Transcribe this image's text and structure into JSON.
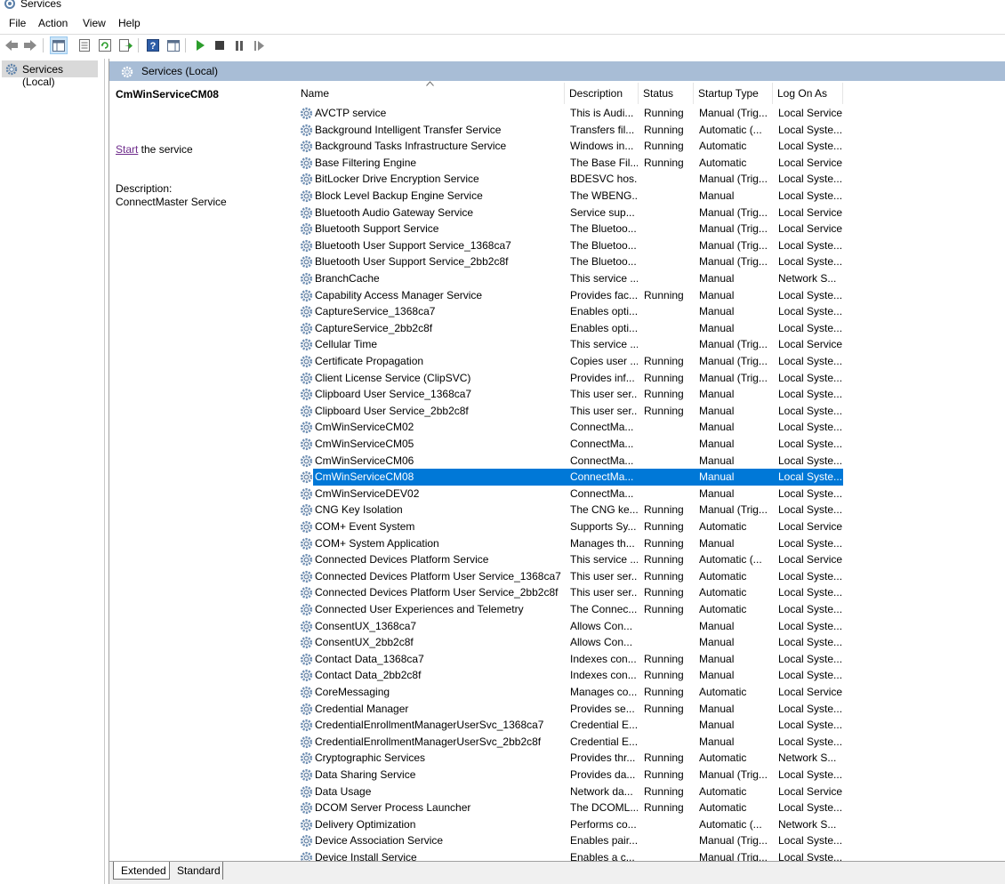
{
  "window": {
    "title": "Services"
  },
  "menu": [
    "File",
    "Action",
    "View",
    "Help"
  ],
  "toolbar": {
    "buttons": [
      "back-icon",
      "forward-icon",
      "show-hide-console-tree-icon",
      "properties-icon",
      "refresh-icon",
      "export-list-icon",
      "help-icon",
      "show-action-pane-icon",
      "start-service-icon",
      "stop-service-icon",
      "pause-service-icon",
      "resume-service-icon"
    ]
  },
  "tree": {
    "root": "Services (Local)"
  },
  "pane": {
    "title": "Services (Local)"
  },
  "details": {
    "service_name": "CmWinServiceCM08",
    "start_link": "Start",
    "start_suffix": " the service",
    "description_label": "Description:",
    "description": "ConnectMaster Service"
  },
  "columns": [
    "Name",
    "Description",
    "Status",
    "Startup Type",
    "Log On As"
  ],
  "selected_index": 22,
  "colors": {
    "selection": "#0078d7",
    "header": "#a8bdd6",
    "link": "#6e2b8b"
  },
  "rows": [
    [
      "AVCTP service",
      "This is Audi...",
      "Running",
      "Manual (Trig...",
      "Local Service"
    ],
    [
      "Background Intelligent Transfer Service",
      "Transfers fil...",
      "Running",
      "Automatic (...",
      "Local Syste..."
    ],
    [
      "Background Tasks Infrastructure Service",
      "Windows in...",
      "Running",
      "Automatic",
      "Local Syste..."
    ],
    [
      "Base Filtering Engine",
      "The Base Fil...",
      "Running",
      "Automatic",
      "Local Service"
    ],
    [
      "BitLocker Drive Encryption Service",
      "BDESVC hos...",
      "",
      "Manual (Trig...",
      "Local Syste..."
    ],
    [
      "Block Level Backup Engine Service",
      "The WBENG...",
      "",
      "Manual",
      "Local Syste..."
    ],
    [
      "Bluetooth Audio Gateway Service",
      "Service sup...",
      "",
      "Manual (Trig...",
      "Local Service"
    ],
    [
      "Bluetooth Support Service",
      "The Bluetoo...",
      "",
      "Manual (Trig...",
      "Local Service"
    ],
    [
      "Bluetooth User Support Service_1368ca7",
      "The Bluetoo...",
      "",
      "Manual (Trig...",
      "Local Syste..."
    ],
    [
      "Bluetooth User Support Service_2bb2c8f",
      "The Bluetoo...",
      "",
      "Manual (Trig...",
      "Local Syste..."
    ],
    [
      "BranchCache",
      "This service ...",
      "",
      "Manual",
      "Network S..."
    ],
    [
      "Capability Access Manager Service",
      "Provides fac...",
      "Running",
      "Manual",
      "Local Syste..."
    ],
    [
      "CaptureService_1368ca7",
      "Enables opti...",
      "",
      "Manual",
      "Local Syste..."
    ],
    [
      "CaptureService_2bb2c8f",
      "Enables opti...",
      "",
      "Manual",
      "Local Syste..."
    ],
    [
      "Cellular Time",
      "This service ...",
      "",
      "Manual (Trig...",
      "Local Service"
    ],
    [
      "Certificate Propagation",
      "Copies user ...",
      "Running",
      "Manual (Trig...",
      "Local Syste..."
    ],
    [
      "Client License Service (ClipSVC)",
      "Provides inf...",
      "Running",
      "Manual (Trig...",
      "Local Syste..."
    ],
    [
      "Clipboard User Service_1368ca7",
      "This user ser...",
      "Running",
      "Manual",
      "Local Syste..."
    ],
    [
      "Clipboard User Service_2bb2c8f",
      "This user ser...",
      "Running",
      "Manual",
      "Local Syste..."
    ],
    [
      "CmWinServiceCM02",
      "ConnectMa...",
      "",
      "Manual",
      "Local Syste..."
    ],
    [
      "CmWinServiceCM05",
      "ConnectMa...",
      "",
      "Manual",
      "Local Syste..."
    ],
    [
      "CmWinServiceCM06",
      "ConnectMa...",
      "",
      "Manual",
      "Local Syste..."
    ],
    [
      "CmWinServiceCM08",
      "ConnectMa...",
      "",
      "Manual",
      "Local Syste..."
    ],
    [
      "CmWinServiceDEV02",
      "ConnectMa...",
      "",
      "Manual",
      "Local Syste..."
    ],
    [
      "CNG Key Isolation",
      "The CNG ke...",
      "Running",
      "Manual (Trig...",
      "Local Syste..."
    ],
    [
      "COM+ Event System",
      "Supports Sy...",
      "Running",
      "Automatic",
      "Local Service"
    ],
    [
      "COM+ System Application",
      "Manages th...",
      "Running",
      "Manual",
      "Local Syste..."
    ],
    [
      "Connected Devices Platform Service",
      "This service ...",
      "Running",
      "Automatic (...",
      "Local Service"
    ],
    [
      "Connected Devices Platform User Service_1368ca7",
      "This user ser...",
      "Running",
      "Automatic",
      "Local Syste..."
    ],
    [
      "Connected Devices Platform User Service_2bb2c8f",
      "This user ser...",
      "Running",
      "Automatic",
      "Local Syste..."
    ],
    [
      "Connected User Experiences and Telemetry",
      "The Connec...",
      "Running",
      "Automatic",
      "Local Syste..."
    ],
    [
      "ConsentUX_1368ca7",
      "Allows Con...",
      "",
      "Manual",
      "Local Syste..."
    ],
    [
      "ConsentUX_2bb2c8f",
      "Allows Con...",
      "",
      "Manual",
      "Local Syste..."
    ],
    [
      "Contact Data_1368ca7",
      "Indexes con...",
      "Running",
      "Manual",
      "Local Syste..."
    ],
    [
      "Contact Data_2bb2c8f",
      "Indexes con...",
      "Running",
      "Manual",
      "Local Syste..."
    ],
    [
      "CoreMessaging",
      "Manages co...",
      "Running",
      "Automatic",
      "Local Service"
    ],
    [
      "Credential Manager",
      "Provides se...",
      "Running",
      "Manual",
      "Local Syste..."
    ],
    [
      "CredentialEnrollmentManagerUserSvc_1368ca7",
      "Credential E...",
      "",
      "Manual",
      "Local Syste..."
    ],
    [
      "CredentialEnrollmentManagerUserSvc_2bb2c8f",
      "Credential E...",
      "",
      "Manual",
      "Local Syste..."
    ],
    [
      "Cryptographic Services",
      "Provides thr...",
      "Running",
      "Automatic",
      "Network S..."
    ],
    [
      "Data Sharing Service",
      "Provides da...",
      "Running",
      "Manual (Trig...",
      "Local Syste..."
    ],
    [
      "Data Usage",
      "Network da...",
      "Running",
      "Automatic",
      "Local Service"
    ],
    [
      "DCOM Server Process Launcher",
      "The DCOML...",
      "Running",
      "Automatic",
      "Local Syste..."
    ],
    [
      "Delivery Optimization",
      "Performs co...",
      "",
      "Automatic (...",
      "Network S..."
    ],
    [
      "Device Association Service",
      "Enables pair...",
      "",
      "Manual (Trig...",
      "Local Syste..."
    ],
    [
      "Device Install Service",
      "Enables a c...",
      "",
      "Manual (Trig...",
      "Local Syste..."
    ]
  ],
  "tabs": [
    "Extended",
    "Standard"
  ]
}
